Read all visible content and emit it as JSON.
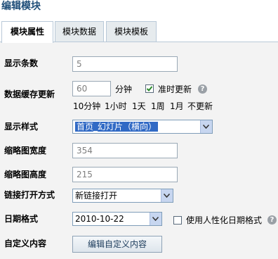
{
  "title": "编辑模块",
  "tabs": [
    "模块属性",
    "模块数据",
    "模块模板"
  ],
  "fields": {
    "display_count": {
      "label": "显示条数",
      "value": "5"
    },
    "cache": {
      "label": "数据缓存更新",
      "value": "60",
      "unit": "分钟",
      "ontime_label": "准时更新",
      "ontime_checked": true,
      "quick_options": [
        "10分钟",
        "1小时",
        "1天",
        "1周",
        "1月",
        "不更新"
      ]
    },
    "style": {
      "label": "显示样式",
      "value": "首页_幻灯片（横向）"
    },
    "thumb_width": {
      "label": "缩略图宽度",
      "value": "354"
    },
    "thumb_height": {
      "label": "缩略图高度",
      "value": "215"
    },
    "link_open": {
      "label": "链接打开方式",
      "value": "新链接打开"
    },
    "date_format": {
      "label": "日期格式",
      "value": "2010-10-22",
      "humanize_label": "使用人性化日期格式",
      "humanize_checked": false
    },
    "custom": {
      "label": "自定义内容",
      "button": "编辑自定义内容"
    }
  },
  "help_icon": "?",
  "colors": {
    "title": "#1f4e79",
    "select_highlight": "#316ac5"
  }
}
